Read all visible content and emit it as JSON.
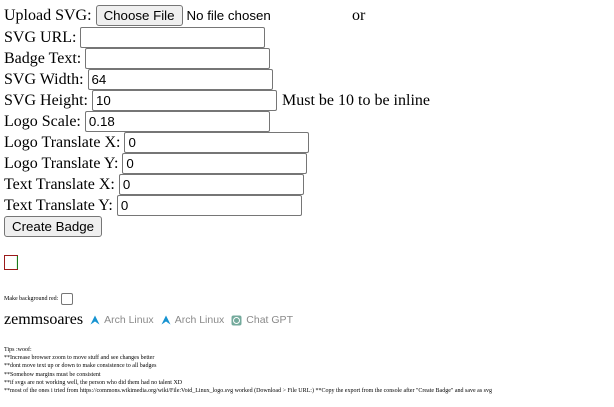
{
  "form": {
    "upload_label": "Upload SVG:",
    "choose_file_label": "Choose File",
    "file_status": "No file chosen",
    "or_text": "or",
    "svg_url_label": "SVG URL:",
    "svg_url_value": "",
    "badge_text_label": "Badge Text:",
    "badge_text_value": "",
    "svg_width_label": "SVG Width:",
    "svg_width_value": "64",
    "svg_height_label": "SVG Height:",
    "svg_height_value": "10",
    "svg_height_note": "Must be 10 to be inline",
    "logo_scale_label": "Logo Scale:",
    "logo_scale_value": "0.18",
    "logo_tx_label": "Logo Translate X:",
    "logo_tx_value": "0",
    "logo_ty_label": "Logo Translate Y:",
    "logo_ty_value": "0",
    "text_tx_label": "Text Translate X:",
    "text_tx_value": "0",
    "text_ty_label": "Text Translate Y:",
    "text_ty_value": "0",
    "create_button_label": "Create Badge"
  },
  "background_toggle": {
    "label": "Make background red:",
    "checked": false
  },
  "badges_row": {
    "username": "zemmsoares",
    "badges": [
      {
        "icon": "arch-linux-icon",
        "label": "Arch Linux",
        "color": "#1793d1"
      },
      {
        "icon": "arch-linux-icon",
        "label": "Arch Linux",
        "color": "#1793d1"
      },
      {
        "icon": "chatgpt-icon",
        "label": "Chat GPT",
        "color": "#74aa9c"
      }
    ]
  },
  "tips": {
    "lines": [
      "Tips :woof:",
      "**Increase browser zoom to move stuff and see changes better",
      "**dont move text up or down to make consistence to all badges",
      "**Somehow margins must be consistent",
      "**if svgs are not working well, the person who did them had no talent XD",
      "**most of the ones i tried from https://commons.wikimedia.org/wiki/File:Void_Linux_logo.svg worked (Download > File URL:) **Copy the export from the console after \"Create Badge\" and save as svg"
    ]
  }
}
